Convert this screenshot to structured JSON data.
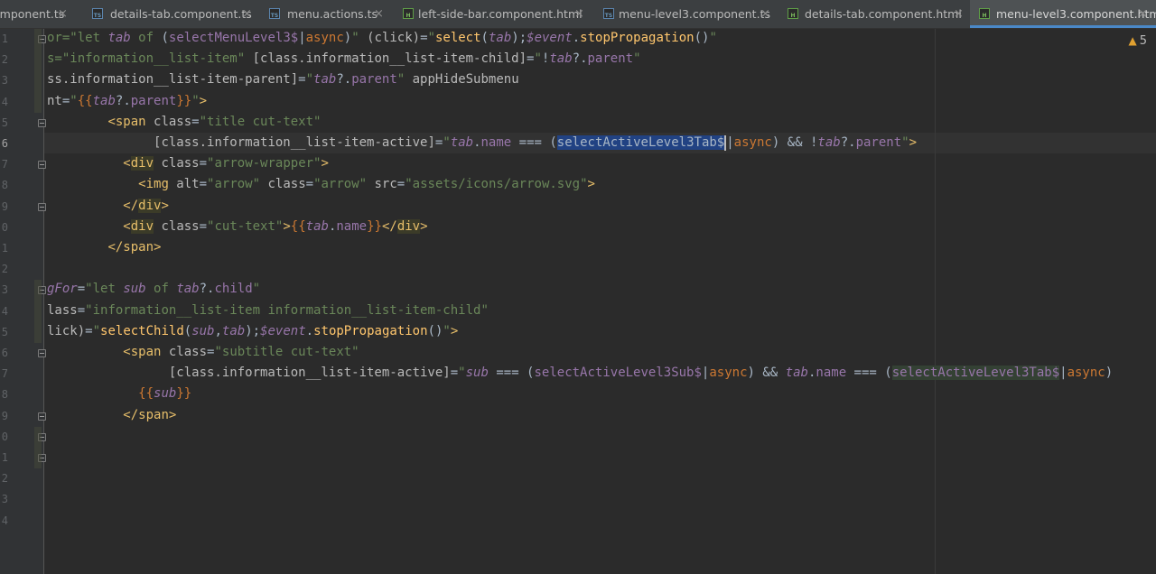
{
  "tabs": [
    {
      "label": "omponent.ts",
      "type": "ts",
      "close": "×",
      "active": false
    },
    {
      "label": "details-tab.component.ts",
      "type": "ts",
      "close": "×",
      "active": false
    },
    {
      "label": "menu.actions.ts",
      "type": "ts",
      "close": "×",
      "active": false
    },
    {
      "label": "left-side-bar.component.html",
      "type": "html",
      "close": "×",
      "active": false
    },
    {
      "label": "menu-level3.component.ts",
      "type": "ts",
      "close": "×",
      "active": false
    },
    {
      "label": "details-tab.component.html",
      "type": "html",
      "close": "×",
      "active": false
    },
    {
      "label": "menu-level3.component.html",
      "type": "html",
      "close": "×",
      "active": true
    }
  ],
  "icon_text": {
    "ts": "TS",
    "html": "H"
  },
  "inspection": {
    "icon": "warning-icon",
    "count": "5"
  },
  "line_numbers": [
    "1",
    "2",
    "3",
    "4",
    "5",
    "6",
    "7",
    "8",
    "9",
    "0",
    "1",
    "2",
    "3",
    "4",
    "5",
    "6",
    "7",
    "8",
    "9",
    "0",
    "1",
    "2",
    "3",
    "4"
  ],
  "code_lines": [
    [
      [
        "str",
        "or=\"let "
      ],
      [
        "var",
        "tab"
      ],
      [
        "str",
        " of "
      ],
      [
        "plain",
        "("
      ],
      [
        "prop",
        "selectMenuLevel3$"
      ],
      [
        "plain",
        "|"
      ],
      [
        "kw",
        "async"
      ],
      [
        "plain",
        ")"
      ],
      [
        "str",
        "\""
      ],
      [
        "attr",
        " (click)"
      ],
      [
        "plain",
        "="
      ],
      [
        "str",
        "\""
      ],
      [
        "fn",
        "select"
      ],
      [
        "plain",
        "("
      ],
      [
        "var",
        "tab"
      ],
      [
        "plain",
        ");"
      ],
      [
        "var",
        "$event"
      ],
      [
        "plain",
        "."
      ],
      [
        "fn",
        "stopPropagation"
      ],
      [
        "plain",
        "()"
      ],
      [
        "str",
        "\""
      ]
    ],
    [
      [
        "str",
        "s=\"information__list-item\""
      ],
      [
        "attr",
        " [class.information__list-item-child]"
      ],
      [
        "plain",
        "="
      ],
      [
        "str",
        "\""
      ],
      [
        "plain",
        "!"
      ],
      [
        "var",
        "tab"
      ],
      [
        "plain",
        "?."
      ],
      [
        "prop",
        "parent"
      ],
      [
        "str",
        "\""
      ]
    ],
    [
      [
        "attr",
        "ss.information__list-item-parent]"
      ],
      [
        "plain",
        "="
      ],
      [
        "str",
        "\""
      ],
      [
        "var",
        "tab"
      ],
      [
        "plain",
        "?."
      ],
      [
        "prop",
        "parent"
      ],
      [
        "str",
        "\""
      ],
      [
        "attr",
        " appHideSubmenu"
      ]
    ],
    [
      [
        "attr",
        "nt"
      ],
      [
        "plain",
        "="
      ],
      [
        "str",
        "\""
      ],
      [
        "kw",
        "{{"
      ],
      [
        "var",
        "tab"
      ],
      [
        "plain",
        "?."
      ],
      [
        "prop",
        "parent"
      ],
      [
        "kw",
        "}}"
      ],
      [
        "str",
        "\""
      ],
      [
        "tag",
        ">"
      ]
    ],
    [
      [
        "plain",
        "        "
      ],
      [
        "tag",
        "<span"
      ],
      [
        "attr",
        " class"
      ],
      [
        "plain",
        "="
      ],
      [
        "str",
        "\"title cut-text\""
      ]
    ],
    [
      [
        "plain",
        "              "
      ],
      [
        "attr",
        "[class.information__list-item-active]"
      ],
      [
        "plain",
        "="
      ],
      [
        "str",
        "\""
      ],
      [
        "var",
        "tab"
      ],
      [
        "plain",
        "."
      ],
      [
        "prop",
        "name"
      ],
      [
        "plain",
        " === ("
      ],
      [
        "sel",
        "selectActiveLevel3Tab$"
      ],
      [
        "caret",
        ""
      ],
      [
        "plain",
        "|"
      ],
      [
        "kw",
        "async"
      ],
      [
        "plain",
        ") && !"
      ],
      [
        "var",
        "tab"
      ],
      [
        "plain",
        "?."
      ],
      [
        "prop",
        "parent"
      ],
      [
        "str",
        "\""
      ],
      [
        "tag",
        ">"
      ]
    ],
    [
      [
        "plain",
        "          "
      ],
      [
        "tag",
        "<"
      ],
      [
        "tagbg",
        "div"
      ],
      [
        "attr",
        " class"
      ],
      [
        "plain",
        "="
      ],
      [
        "str",
        "\"arrow-wrapper\""
      ],
      [
        "tag",
        ">"
      ]
    ],
    [
      [
        "plain",
        "            "
      ],
      [
        "tag",
        "<img"
      ],
      [
        "attr",
        " alt"
      ],
      [
        "plain",
        "="
      ],
      [
        "str",
        "\"arrow\""
      ],
      [
        "attr",
        " class"
      ],
      [
        "plain",
        "="
      ],
      [
        "str",
        "\"arrow\""
      ],
      [
        "attr",
        " src"
      ],
      [
        "plain",
        "="
      ],
      [
        "str",
        "\"assets/icons/arrow.svg\""
      ],
      [
        "tag",
        ">"
      ]
    ],
    [
      [
        "plain",
        "          "
      ],
      [
        "tag",
        "</"
      ],
      [
        "tagbg",
        "div"
      ],
      [
        "tag",
        ">"
      ]
    ],
    [
      [
        "plain",
        "          "
      ],
      [
        "tag",
        "<"
      ],
      [
        "tagbg",
        "div"
      ],
      [
        "attr",
        " class"
      ],
      [
        "plain",
        "="
      ],
      [
        "str",
        "\"cut-text\""
      ],
      [
        "tag",
        ">"
      ],
      [
        "kw",
        "{{"
      ],
      [
        "var",
        "tab"
      ],
      [
        "plain",
        "."
      ],
      [
        "prop",
        "name"
      ],
      [
        "kw",
        "}}"
      ],
      [
        "tag",
        "</"
      ],
      [
        "tagbg",
        "div"
      ],
      [
        "tag",
        ">"
      ]
    ],
    [
      [
        "plain",
        "        "
      ],
      [
        "tag",
        "</span>"
      ]
    ],
    [
      [
        "plain",
        ""
      ]
    ],
    [
      [
        "var",
        "gFor"
      ],
      [
        "plain",
        "="
      ],
      [
        "str",
        "\"let "
      ],
      [
        "var",
        "sub"
      ],
      [
        "str",
        " of "
      ],
      [
        "var",
        "tab"
      ],
      [
        "plain",
        "?."
      ],
      [
        "prop",
        "child"
      ],
      [
        "str",
        "\""
      ]
    ],
    [
      [
        "attr",
        "lass"
      ],
      [
        "plain",
        "="
      ],
      [
        "str",
        "\"information__list-item information__list-item-child\""
      ]
    ],
    [
      [
        "attr",
        "lick)"
      ],
      [
        "plain",
        "="
      ],
      [
        "str",
        "\""
      ],
      [
        "fn",
        "selectChild"
      ],
      [
        "plain",
        "("
      ],
      [
        "var",
        "sub"
      ],
      [
        "plain",
        ","
      ],
      [
        "var",
        "tab"
      ],
      [
        "plain",
        ");"
      ],
      [
        "var",
        "$event"
      ],
      [
        "plain",
        "."
      ],
      [
        "fn",
        "stopPropagation"
      ],
      [
        "plain",
        "()"
      ],
      [
        "str",
        "\""
      ],
      [
        "tag",
        ">"
      ]
    ],
    [
      [
        "plain",
        "          "
      ],
      [
        "tag",
        "<span"
      ],
      [
        "attr",
        " class"
      ],
      [
        "plain",
        "="
      ],
      [
        "str",
        "\"subtitle cut-text\""
      ]
    ],
    [
      [
        "plain",
        "                "
      ],
      [
        "attr",
        "[class.information__list-item-active]"
      ],
      [
        "plain",
        "="
      ],
      [
        "str",
        "\""
      ],
      [
        "var",
        "sub"
      ],
      [
        "plain",
        " === ("
      ],
      [
        "prop",
        "selectActiveLevel3Sub$"
      ],
      [
        "plain",
        "|"
      ],
      [
        "kw",
        "async"
      ],
      [
        "plain",
        ") && "
      ],
      [
        "var",
        "tab"
      ],
      [
        "plain",
        "."
      ],
      [
        "prop",
        "name"
      ],
      [
        "plain",
        " === ("
      ],
      [
        "usage",
        "selectActiveLevel3Tab$"
      ],
      [
        "plain",
        "|"
      ],
      [
        "kw",
        "async"
      ],
      [
        "plain",
        ")"
      ]
    ],
    [
      [
        "plain",
        "            "
      ],
      [
        "kw",
        "{{"
      ],
      [
        "var",
        "sub"
      ],
      [
        "kw",
        "}}"
      ]
    ],
    [
      [
        "plain",
        "          "
      ],
      [
        "tag",
        "</span>"
      ]
    ]
  ]
}
